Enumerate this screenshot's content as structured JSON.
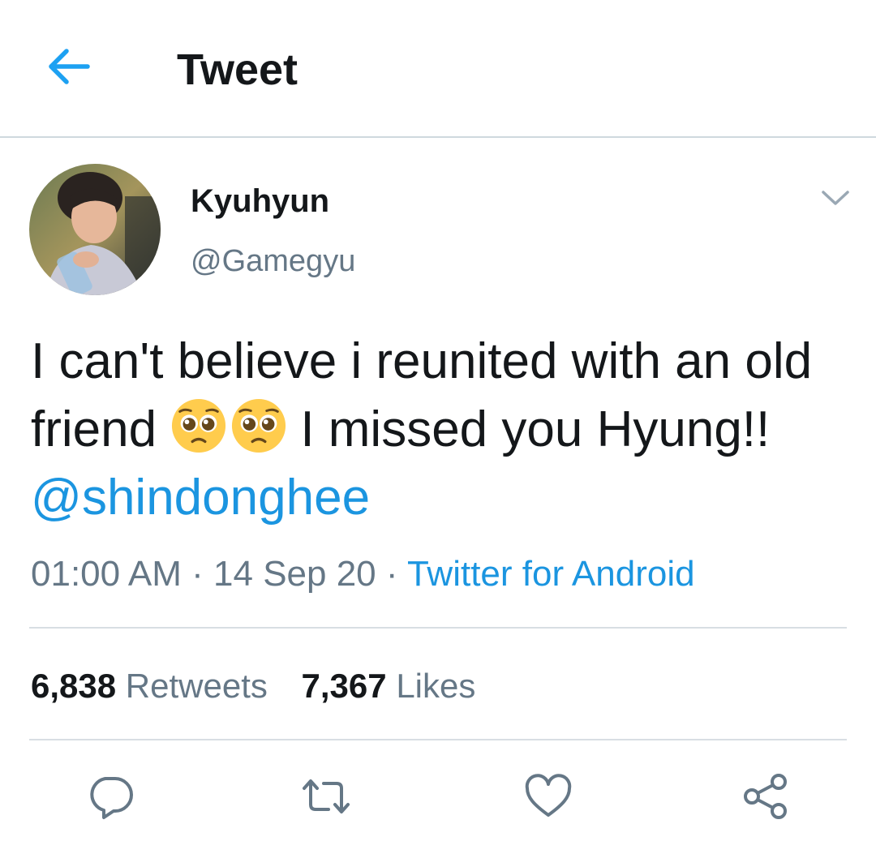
{
  "header": {
    "title": "Tweet",
    "back_icon": "arrow-left-icon"
  },
  "tweet": {
    "author": {
      "display_name": "Kyuhyun",
      "handle": "@Gamegyu",
      "avatar": "user-avatar-photo"
    },
    "text_part1": "I can't believe i reunited with an old friend",
    "emoji_name": "pleading-face-emoji",
    "text_part2": "I missed you Hyung!!",
    "mention": "@shindonghee",
    "time": "01:00 AM",
    "separator": "·",
    "date": "14 Sep 20",
    "source": "Twitter for Android",
    "menu_icon": "chevron-down-icon"
  },
  "stats": {
    "retweets_count": "6,838",
    "retweets_label": "Retweets",
    "likes_count": "7,367",
    "likes_label": "Likes"
  },
  "actions": [
    {
      "name": "reply",
      "icon": "reply-icon"
    },
    {
      "name": "retweet",
      "icon": "retweet-icon"
    },
    {
      "name": "like",
      "icon": "heart-icon"
    },
    {
      "name": "share",
      "icon": "share-icon"
    }
  ],
  "colors": {
    "accent": "#1b95e0",
    "back_arrow": "#1da1f2",
    "primary_text": "#14171a",
    "secondary_text": "#657786",
    "divider": "#d8dee3",
    "emoji_face": "#ffcc4d"
  }
}
